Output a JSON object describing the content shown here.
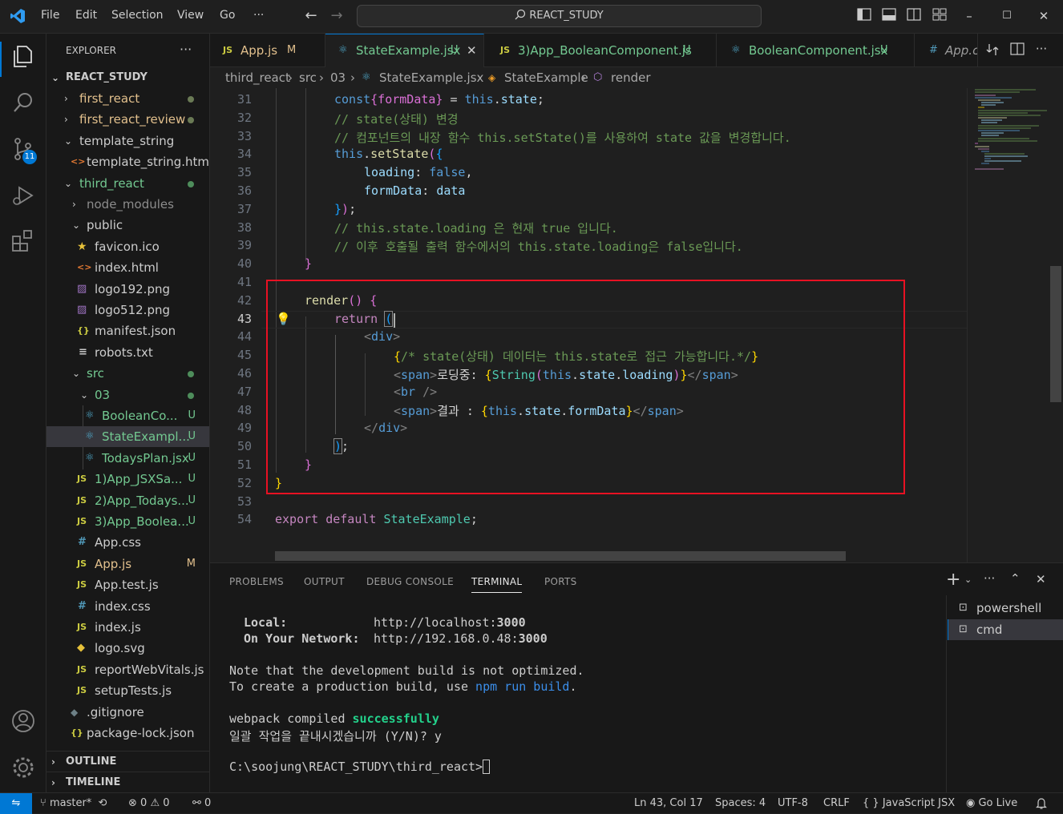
{
  "titlebar": {
    "menu": [
      "File",
      "Edit",
      "Selection",
      "View",
      "Go",
      "···"
    ],
    "search": "REACT_STUDY"
  },
  "activity": {
    "scm_badge": "11"
  },
  "sidebar": {
    "title": "EXPLORER",
    "more": "···",
    "root": "REACT_STUDY",
    "items": [
      {
        "label": "first_react"
      },
      {
        "label": "first_react_review"
      },
      {
        "label": "template_string"
      },
      {
        "label": "template_string.html"
      },
      {
        "label": "third_react"
      },
      {
        "label": "node_modules"
      },
      {
        "label": "public"
      },
      {
        "label": "favicon.ico"
      },
      {
        "label": "index.html"
      },
      {
        "label": "logo192.png"
      },
      {
        "label": "logo512.png"
      },
      {
        "label": "manifest.json"
      },
      {
        "label": "robots.txt"
      },
      {
        "label": "src"
      },
      {
        "label": "03"
      },
      {
        "label": "BooleanCo...",
        "deco": "U"
      },
      {
        "label": "StateExampl...",
        "deco": "U"
      },
      {
        "label": "TodaysPlan.jsx",
        "deco": "U"
      },
      {
        "label": "1)App_JSXSa...",
        "deco": "U"
      },
      {
        "label": "2)App_Todays...",
        "deco": "U"
      },
      {
        "label": "3)App_Boolea...",
        "deco": "U"
      },
      {
        "label": "App.css"
      },
      {
        "label": "App.js",
        "deco": "M"
      },
      {
        "label": "App.test.js"
      },
      {
        "label": "index.css"
      },
      {
        "label": "index.js"
      },
      {
        "label": "logo.svg"
      },
      {
        "label": "reportWebVitals.js"
      },
      {
        "label": "setupTests.js"
      },
      {
        "label": ".gitignore"
      },
      {
        "label": "package-lock.json"
      }
    ],
    "outline": "OUTLINE",
    "timeline": "TIMELINE"
  },
  "tabs": [
    {
      "label": "App.js",
      "deco": "M",
      "icon": "JS"
    },
    {
      "label": "StateExample.jsx",
      "deco": "U",
      "close": "✕"
    },
    {
      "label": "3)App_BooleanComponent.js",
      "deco": "U",
      "icon": "JS"
    },
    {
      "label": "BooleanComponent.jsx",
      "deco": "U"
    },
    {
      "label": "App.c",
      "icon": "#"
    }
  ],
  "breadcrumb": [
    "third_react",
    "src",
    "03",
    "StateExample.jsx",
    "StateExample",
    "render"
  ],
  "editor": {
    "line_numbers": [
      "31",
      "32",
      "33",
      "34",
      "35",
      "36",
      "37",
      "38",
      "39",
      "40",
      "41",
      "42",
      "43",
      "44",
      "45",
      "46",
      "47",
      "48",
      "49",
      "50",
      "51",
      "52",
      "53",
      "54"
    ],
    "current_line": "43",
    "code": {
      "l31": [
        "const",
        "{formData}",
        " = ",
        "this",
        ".",
        "state",
        ";"
      ],
      "l32": "// state(상태) 변경",
      "l33": "// 컴포넌트의 내장 함수 this.setState()를 사용하여 state 값을 변경합니다.",
      "l34": [
        "this",
        ".",
        "setState",
        "(",
        "{"
      ],
      "l35": [
        "loading",
        ": ",
        "false",
        ","
      ],
      "l36": [
        "formData",
        ": ",
        "data"
      ],
      "l37": [
        "}",
        ")",
        ";"
      ],
      "l38": "// this.state.loading 은 현재 true 입니다.",
      "l39": "// 이후 호출될 출력 함수에서의 this.state.loading은 false입니다.",
      "l40": "}",
      "l42": [
        "render",
        "()",
        " ",
        "{"
      ],
      "l43": [
        "return",
        " ",
        "("
      ],
      "l44": [
        "<",
        "div",
        ">"
      ],
      "l45": [
        "{",
        "/* state(상태) 데이터는 this.state로 접근 가능합니다.*/",
        "}"
      ],
      "l46": [
        "<",
        "span",
        ">",
        "로딩중: ",
        "{",
        "String",
        "(",
        "this",
        ".",
        "state",
        ".",
        "loading",
        ")",
        "}",
        "</",
        "span",
        ">"
      ],
      "l47": [
        "<",
        "br",
        " />"
      ],
      "l48": [
        "<",
        "span",
        ">",
        "결과 : ",
        "{",
        "this",
        ".",
        "state",
        ".",
        "formData",
        "}",
        "</",
        "span",
        ">"
      ],
      "l49": [
        "</",
        "div",
        ">"
      ],
      "l50": [
        ")",
        ";"
      ],
      "l51": "}",
      "l52": "}",
      "l54": [
        "export",
        " ",
        "default",
        " ",
        "StateExample",
        ";"
      ]
    }
  },
  "panel": {
    "tabs": [
      "PROBLEMS",
      "OUTPUT",
      "DEBUG CONSOLE",
      "TERMINAL",
      "PORTS"
    ],
    "active_tab": "TERMINAL",
    "terminals": [
      "powershell",
      "cmd"
    ],
    "lines": {
      "local_label": "Local:",
      "local_url": "http://localhost:",
      "local_port": "3000",
      "net_label": "On Your Network:",
      "net_url": "http://192.168.0.48:",
      "net_port": "3000",
      "note1": "Note that the development build is not optimized.",
      "note2a": "To create a production build, use ",
      "note2b": "npm run build",
      "note2c": ".",
      "compiled_a": "webpack compiled ",
      "compiled_b": "successfully",
      "batch": "일괄 작업을 끝내시겠습니까 (Y/N)? y",
      "prompt": "C:\\soojung\\REACT_STUDY\\third_react>"
    }
  },
  "statusbar": {
    "branch": "master*",
    "errors": "0",
    "warnings": "0",
    "ports": "0",
    "position": "Ln 43, Col 17",
    "spaces": "Spaces: 4",
    "encoding": "UTF-8",
    "eol": "CRLF",
    "language": "JavaScript JSX",
    "golive": "Go Live"
  }
}
